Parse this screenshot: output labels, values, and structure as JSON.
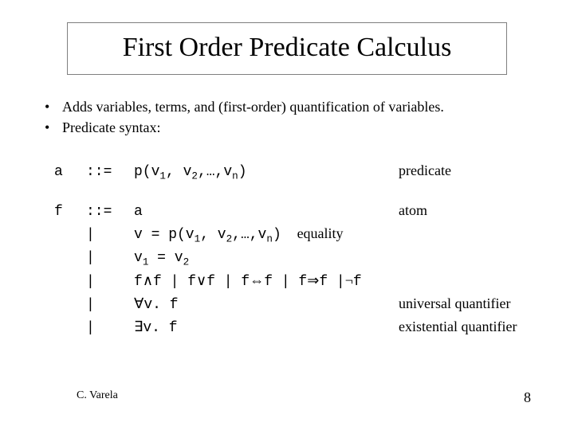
{
  "title": "First Order Predicate Calculus",
  "bullets": [
    "Adds variables, terms, and (first-order) quantification of variables.",
    "Predicate syntax:"
  ],
  "grammar": {
    "a": {
      "nt": "a",
      "op": "::=",
      "prod_prefix": "p(v",
      "prod_s1": "1",
      "prod_mid1": ", v",
      "prod_s2": "2",
      "prod_mid2": ",…,v",
      "prod_sn": "n",
      "prod_suffix": ")",
      "note": "predicate"
    },
    "f": {
      "nt": "f",
      "rows": [
        {
          "op": "::=",
          "type": "atom",
          "text": "a",
          "note": "atom"
        },
        {
          "op": "|",
          "type": "eq",
          "p1": "v = p(v",
          "s1": "1",
          "p2": ", v",
          "s2": "2",
          "p3": ",…,v",
          "sn": "n",
          "p4": ")",
          "note": "equality"
        },
        {
          "op": "|",
          "type": "eq2",
          "p1": "v",
          "s1": "1",
          "p2": " = v",
          "s2": "2"
        },
        {
          "op": "|",
          "type": "conn",
          "t1": "f",
          "c1": "∧",
          "t2": "f | f",
          "c2": "∨",
          "t3": "f | f",
          "c3": "⇔",
          "t4": "f | f",
          "c4": "⇒",
          "t5": "f |",
          "c5": "¬",
          "t6": "f"
        },
        {
          "op": "|",
          "type": "quant",
          "q": "∀",
          "rest": "v. f",
          "note": "universal quantifier"
        },
        {
          "op": "|",
          "type": "quant",
          "q": "∃",
          "rest": "v. f",
          "note": "existential quantifier"
        }
      ]
    }
  },
  "footer": {
    "left": "C. Varela",
    "right": "8"
  }
}
